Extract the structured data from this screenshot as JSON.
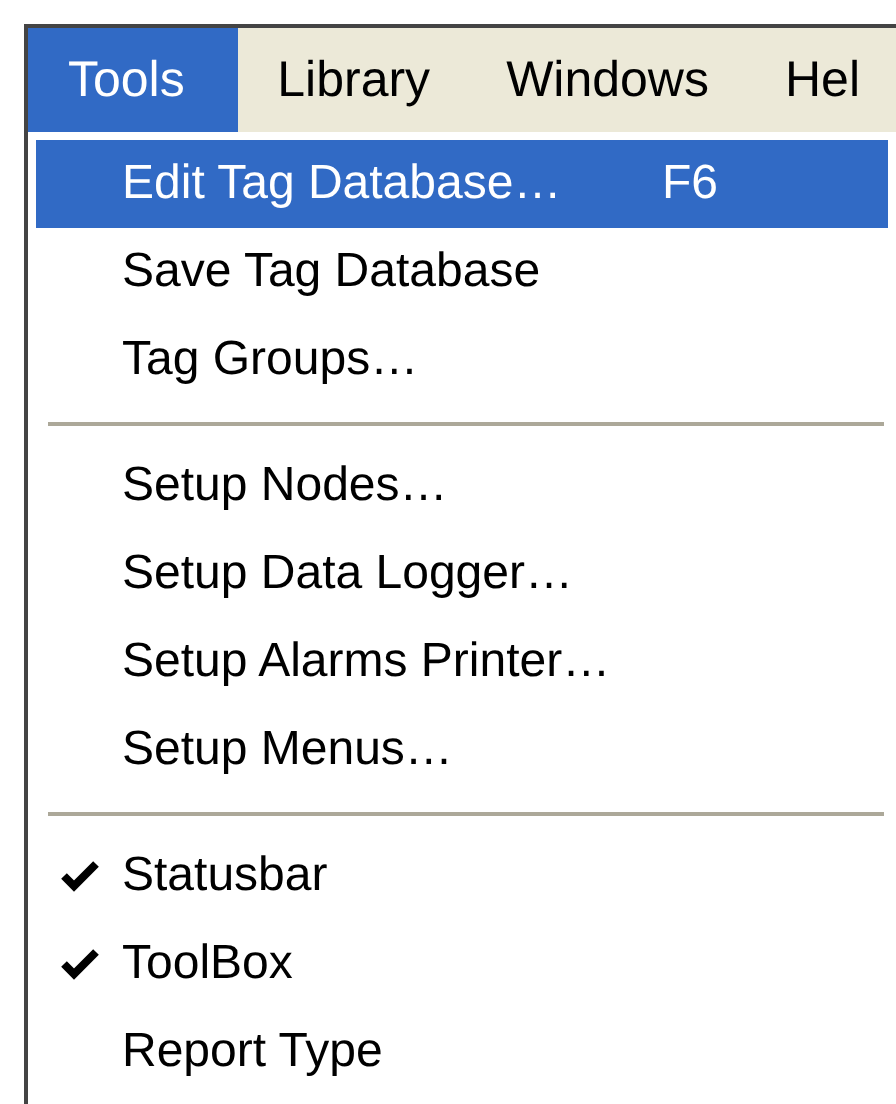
{
  "menubar": [
    {
      "label": "Tools",
      "selected": true
    },
    {
      "label": "Library",
      "selected": false
    },
    {
      "label": "Windows",
      "selected": false
    },
    {
      "label": "Hel",
      "selected": false
    }
  ],
  "menu": [
    {
      "kind": "item",
      "label": "Edit Tag Database…",
      "shortcut": "F6",
      "selected": true,
      "checked": false
    },
    {
      "kind": "item",
      "label": "Save Tag Database",
      "selected": false,
      "checked": false
    },
    {
      "kind": "item",
      "label": "Tag Groups…",
      "selected": false,
      "checked": false
    },
    {
      "kind": "separator"
    },
    {
      "kind": "item",
      "label": "Setup Nodes…",
      "selected": false,
      "checked": false
    },
    {
      "kind": "item",
      "label": "Setup Data Logger…",
      "selected": false,
      "checked": false
    },
    {
      "kind": "item",
      "label": "Setup Alarms Printer…",
      "selected": false,
      "checked": false
    },
    {
      "kind": "item",
      "label": "Setup Menus…",
      "selected": false,
      "checked": false
    },
    {
      "kind": "separator"
    },
    {
      "kind": "item",
      "label": "Statusbar",
      "selected": false,
      "checked": true
    },
    {
      "kind": "item",
      "label": "ToolBox",
      "selected": false,
      "checked": true
    },
    {
      "kind": "item",
      "label": "Report Type",
      "selected": false,
      "checked": false
    }
  ]
}
